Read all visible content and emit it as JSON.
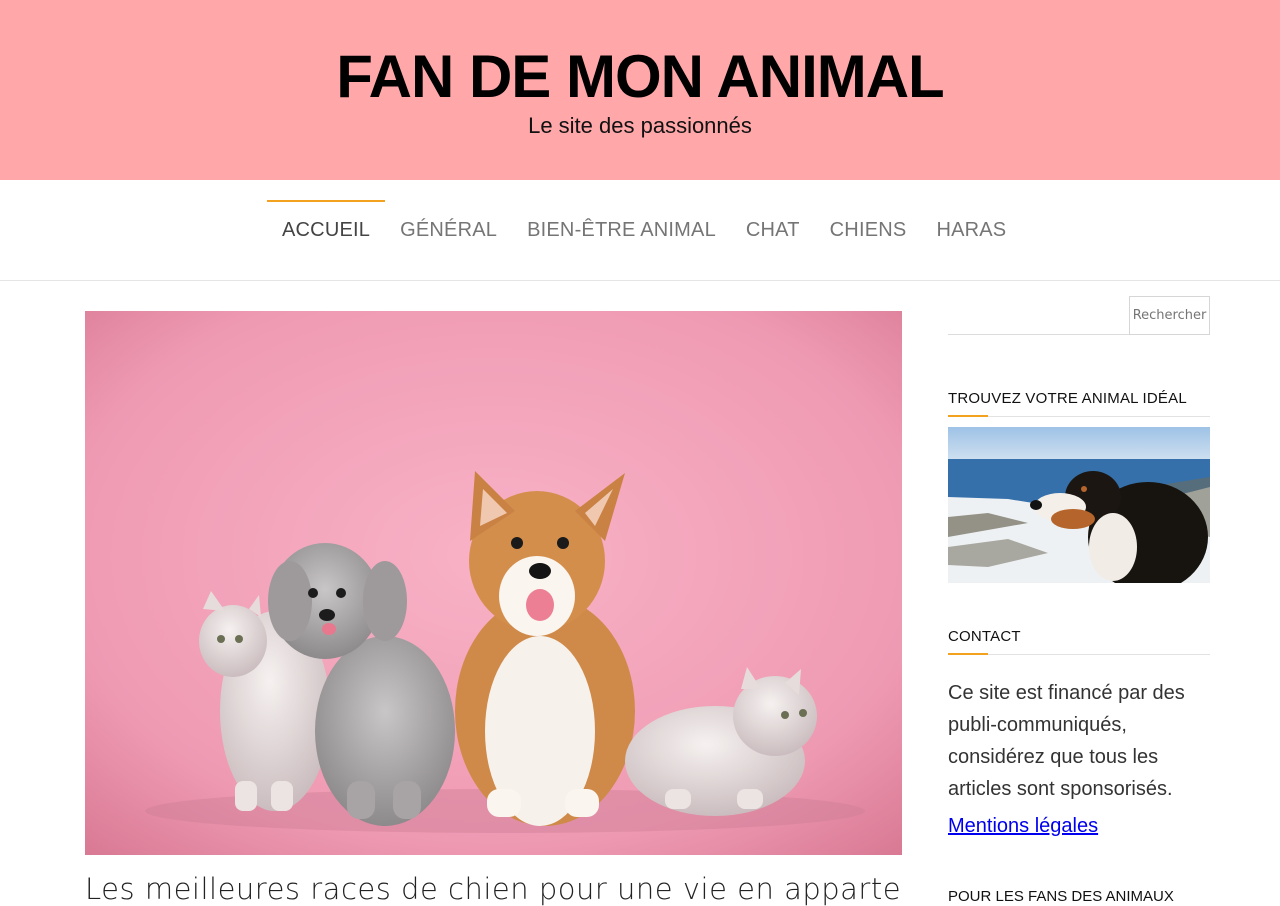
{
  "header": {
    "site_title": "FAN DE MON ANIMAL",
    "tagline": "Le site des passionnés",
    "background_color": "#ffa7a9"
  },
  "nav": {
    "accent_color": "#f2a21f",
    "items": [
      {
        "label": "ACCUEIL",
        "active": true
      },
      {
        "label": "GÉNÉRAL",
        "active": false
      },
      {
        "label": "BIEN-ÊTRE ANIMAL",
        "active": false
      },
      {
        "label": "CHAT",
        "active": false
      },
      {
        "label": "CHIENS",
        "active": false
      },
      {
        "label": "HARAS",
        "active": false
      }
    ]
  },
  "main": {
    "featured_image": "cats-and-dogs-on-pink-background",
    "post_title": "Les meilleures races de chien pour une vie en appartement"
  },
  "sidebar": {
    "search": {
      "value": "",
      "button_label": "Rechercher"
    },
    "widget_animal": {
      "title": "TROUVEZ VOTRE ANIMAL IDÉAL",
      "image": "bernese-mountain-dog-by-sea"
    },
    "widget_contact": {
      "title": "CONTACT",
      "text": "Ce site est financé par des publi-communiqués, considérez que tous les articles sont sponsorisés.",
      "link_label": "Mentions légales"
    },
    "widget_fans": {
      "title": "POUR LES FANS DES ANIMAUX"
    }
  }
}
